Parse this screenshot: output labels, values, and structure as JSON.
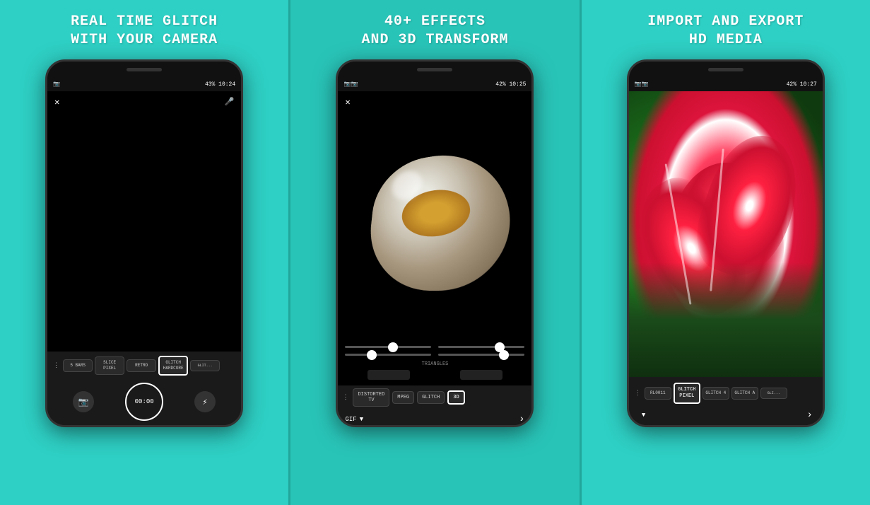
{
  "panels": [
    {
      "id": "left",
      "title_line1": "REAL TIME GLITCH",
      "title_line2": "WITH YOUR CAMERA",
      "status_bar": "43% 10:24",
      "effects": [
        "5 BARS",
        "SLICE\nPIXEL",
        "RETRO",
        "GLITCH\nHARDCORE",
        "GLIT..."
      ],
      "active_effect_index": 3,
      "record_time": "00:00"
    },
    {
      "id": "middle",
      "title_line1": "40+ EFFECTS",
      "title_line2": "AND 3D TRANSFORM",
      "status_bar": "42% 10:25",
      "slider_positions": [
        0.55,
        0.7,
        0.3,
        0.75
      ],
      "effect_name": "TRIANGLES",
      "effects": [
        "DISTORTED\nTV",
        "MPEG",
        "GLITCH",
        "3D"
      ],
      "active_effect_index": 3,
      "export_format": "GIF"
    },
    {
      "id": "right",
      "title_line1": "IMPORT AND EXPORT",
      "title_line2": "HD MEDIA",
      "status_bar": "42% 10:27",
      "effects": [
        "RL0011",
        "GLITCH\nPIXEL",
        "GLITCH 4",
        "GLITCH A",
        "GLI..."
      ],
      "active_effect_index": 1
    }
  ],
  "accent_color": "#2ecfc4",
  "title_color": "#ffffff",
  "phone_bg": "#1a1a1a",
  "active_border": "#ffffff"
}
